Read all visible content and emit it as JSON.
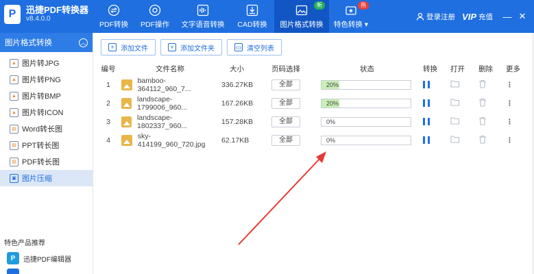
{
  "app": {
    "name": "迅捷PDF转换器",
    "version": "v8.4.0.0",
    "logo_letter": "P"
  },
  "nav": {
    "tabs": [
      {
        "label": "PDF转换",
        "icon": "convert-icon"
      },
      {
        "label": "PDF操作",
        "icon": "settings-icon"
      },
      {
        "label": "文字语音转换",
        "icon": "waveform-icon"
      },
      {
        "label": "CAD转换",
        "icon": "cad-icon"
      },
      {
        "label": "图片格式转换",
        "icon": "image-icon",
        "badge": "新"
      },
      {
        "label": "特色转换",
        "icon": "special-icon",
        "badge": "热"
      }
    ],
    "login": "登录注册",
    "vip_logo": "VIP",
    "vip_text": "充值",
    "minimize": "—",
    "close": "✕"
  },
  "sidebar": {
    "header": "图片格式转换",
    "collapse_glyph": "︿",
    "items": [
      {
        "label": "图片转JPG",
        "icon": "jpg-icon"
      },
      {
        "label": "图片转PNG",
        "icon": "png-icon"
      },
      {
        "label": "图片转BMP",
        "icon": "bmp-icon"
      },
      {
        "label": "图片转ICON",
        "icon": "ico-icon"
      },
      {
        "label": "Word转长图",
        "icon": "word-icon"
      },
      {
        "label": "PPT转长图",
        "icon": "ppt-icon"
      },
      {
        "label": "PDF转长图",
        "icon": "pdf-icon"
      },
      {
        "label": "图片压缩",
        "icon": "compress-icon"
      }
    ],
    "promo_title": "特色产品推荐",
    "promo_item": "迅捷PDF编辑器",
    "promo_logo": "P"
  },
  "toolbar": {
    "add_file": "添加文件",
    "add_folder": "添加文件夹",
    "clear_list": "清空列表"
  },
  "table": {
    "headers": {
      "no": "编号",
      "name": "文件名称",
      "size": "大小",
      "page": "页码选择",
      "status": "状态",
      "convert": "转换",
      "open": "打开",
      "delete": "删除",
      "more": "更多"
    },
    "rows": [
      {
        "no": "1",
        "name": "bamboo-364112_960_7...",
        "size": "336.27KB",
        "page": "全部",
        "progress": "20%",
        "progress_value": 0.2
      },
      {
        "no": "2",
        "name": "landscape-1799006_960...",
        "size": "167.26KB",
        "page": "全部",
        "progress": "20%",
        "progress_value": 0.2
      },
      {
        "no": "3",
        "name": "landscape-1802337_960...",
        "size": "157.28KB",
        "page": "全部",
        "progress": "0%",
        "progress_value": 0
      },
      {
        "no": "4",
        "name": "sky-414199_960_720.jpg",
        "size": "62.17KB",
        "page": "全部",
        "progress": "0%",
        "progress_value": 0
      }
    ]
  },
  "colors": {
    "brand": "#1f6fe0",
    "progress_fill": "#c9efb6",
    "annotation_arrow": "#e53a35"
  }
}
